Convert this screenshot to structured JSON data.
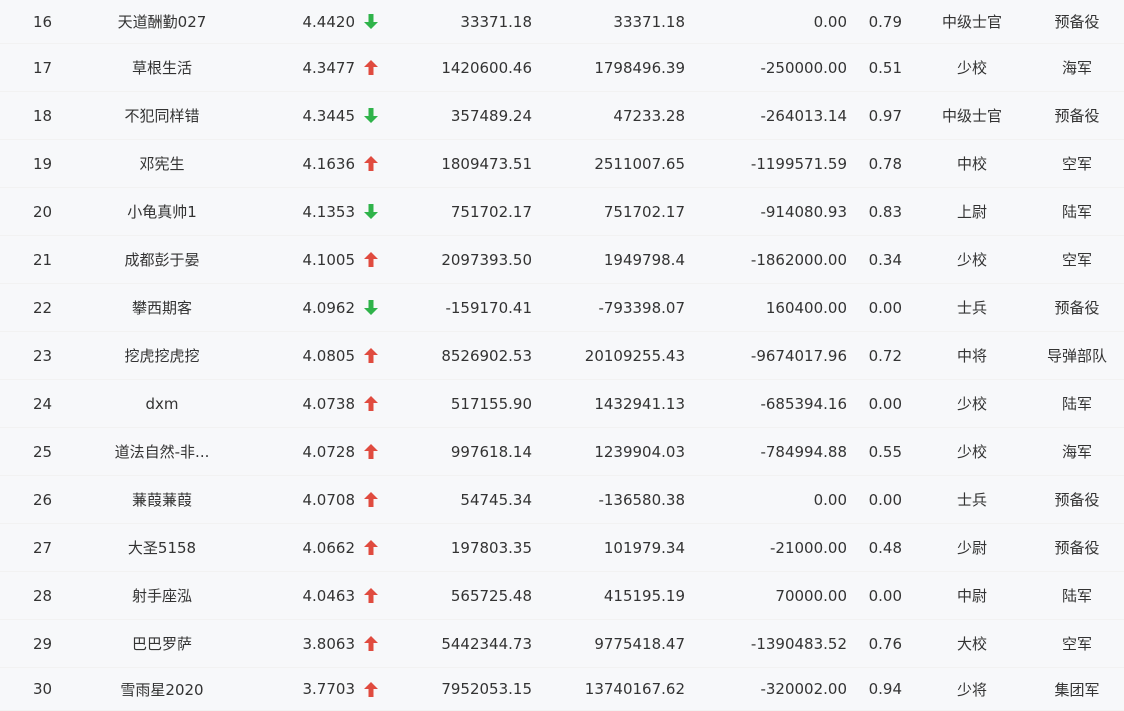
{
  "colors": {
    "up_arrow": "#e04b3f",
    "down_arrow": "#2fb34a"
  },
  "rows": [
    {
      "rank": "16",
      "name": "天道酬勤027",
      "score": "4.4420",
      "trend": "down",
      "trend_icon": "down-arrow-icon",
      "value1": "33371.18",
      "value2": "33371.18",
      "value3": "0.00",
      "ratio": "0.79",
      "military_rank": "中级士官",
      "unit": "预备役"
    },
    {
      "rank": "17",
      "name": "草根生活",
      "score": "4.3477",
      "trend": "up",
      "trend_icon": "up-arrow-icon",
      "value1": "1420600.46",
      "value2": "1798496.39",
      "value3": "-250000.00",
      "ratio": "0.51",
      "military_rank": "少校",
      "unit": "海军"
    },
    {
      "rank": "18",
      "name": "不犯同样错",
      "score": "4.3445",
      "trend": "down",
      "trend_icon": "down-arrow-icon",
      "value1": "357489.24",
      "value2": "47233.28",
      "value3": "-264013.14",
      "ratio": "0.97",
      "military_rank": "中级士官",
      "unit": "预备役"
    },
    {
      "rank": "19",
      "name": "邓宪生",
      "score": "4.1636",
      "trend": "up",
      "trend_icon": "up-arrow-icon",
      "value1": "1809473.51",
      "value2": "2511007.65",
      "value3": "-1199571.59",
      "ratio": "0.78",
      "military_rank": "中校",
      "unit": "空军"
    },
    {
      "rank": "20",
      "name": "小龟真帅1",
      "score": "4.1353",
      "trend": "down",
      "trend_icon": "down-arrow-icon",
      "value1": "751702.17",
      "value2": "751702.17",
      "value3": "-914080.93",
      "ratio": "0.83",
      "military_rank": "上尉",
      "unit": "陆军"
    },
    {
      "rank": "21",
      "name": "成都彭于晏",
      "score": "4.1005",
      "trend": "up",
      "trend_icon": "up-arrow-icon",
      "value1": "2097393.50",
      "value2": "1949798.4",
      "value3": "-1862000.00",
      "ratio": "0.34",
      "military_rank": "少校",
      "unit": "空军"
    },
    {
      "rank": "22",
      "name": "攀西期客",
      "score": "4.0962",
      "trend": "down",
      "trend_icon": "down-arrow-icon",
      "value1": "-159170.41",
      "value2": "-793398.07",
      "value3": "160400.00",
      "ratio": "0.00",
      "military_rank": "士兵",
      "unit": "预备役"
    },
    {
      "rank": "23",
      "name": "挖虎挖虎挖",
      "score": "4.0805",
      "trend": "up",
      "trend_icon": "up-arrow-icon",
      "value1": "8526902.53",
      "value2": "20109255.43",
      "value3": "-9674017.96",
      "ratio": "0.72",
      "military_rank": "中将",
      "unit": "导弹部队"
    },
    {
      "rank": "24",
      "name": "dxm",
      "score": "4.0738",
      "trend": "up",
      "trend_icon": "up-arrow-icon",
      "value1": "517155.90",
      "value2": "1432941.13",
      "value3": "-685394.16",
      "ratio": "0.00",
      "military_rank": "少校",
      "unit": "陆军"
    },
    {
      "rank": "25",
      "name": "道法自然-非...",
      "score": "4.0728",
      "trend": "up",
      "trend_icon": "up-arrow-icon",
      "value1": "997618.14",
      "value2": "1239904.03",
      "value3": "-784994.88",
      "ratio": "0.55",
      "military_rank": "少校",
      "unit": "海军"
    },
    {
      "rank": "26",
      "name": "蒹葭蒹葭",
      "score": "4.0708",
      "trend": "up",
      "trend_icon": "up-arrow-icon",
      "value1": "54745.34",
      "value2": "-136580.38",
      "value3": "0.00",
      "ratio": "0.00",
      "military_rank": "士兵",
      "unit": "预备役"
    },
    {
      "rank": "27",
      "name": "大圣5158",
      "score": "4.0662",
      "trend": "up",
      "trend_icon": "up-arrow-icon",
      "value1": "197803.35",
      "value2": "101979.34",
      "value3": "-21000.00",
      "ratio": "0.48",
      "military_rank": "少尉",
      "unit": "预备役"
    },
    {
      "rank": "28",
      "name": "射手座泓",
      "score": "4.0463",
      "trend": "up",
      "trend_icon": "up-arrow-icon",
      "value1": "565725.48",
      "value2": "415195.19",
      "value3": "70000.00",
      "ratio": "0.00",
      "military_rank": "中尉",
      "unit": "陆军"
    },
    {
      "rank": "29",
      "name": "巴巴罗萨",
      "score": "3.8063",
      "trend": "up",
      "trend_icon": "up-arrow-icon",
      "value1": "5442344.73",
      "value2": "9775418.47",
      "value3": "-1390483.52",
      "ratio": "0.76",
      "military_rank": "大校",
      "unit": "空军"
    },
    {
      "rank": "30",
      "name": "雪雨星2020",
      "score": "3.7703",
      "trend": "up",
      "trend_icon": "up-arrow-icon",
      "value1": "7952053.15",
      "value2": "13740167.62",
      "value3": "-320002.00",
      "ratio": "0.94",
      "military_rank": "少将",
      "unit": "集团军"
    }
  ]
}
